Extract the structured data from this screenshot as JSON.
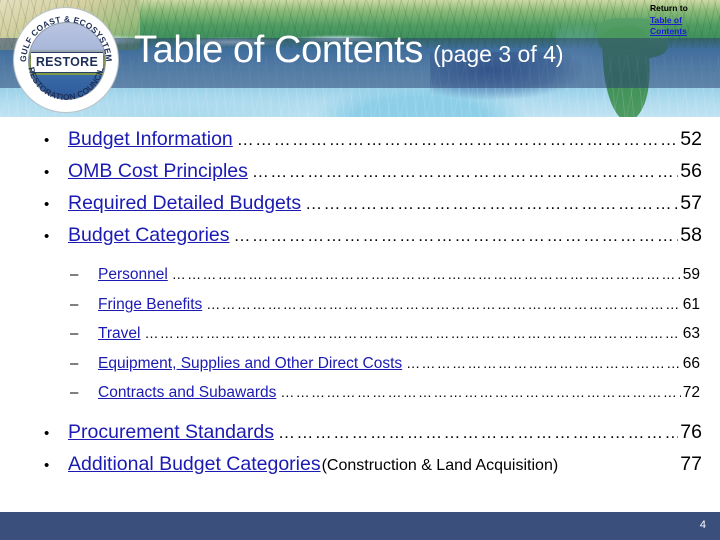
{
  "header": {
    "title_main": "Table of Contents",
    "title_sub": "(page 3 of 4)",
    "logo": {
      "center_text": "RESTORE",
      "arc_top": "GULF COAST & ECOSYSTEM",
      "arc_bottom": "RESTORATION COUNCIL"
    },
    "return_label": "Return to",
    "return_link_line1": "Table of",
    "return_link_line2": "Contents",
    "band_color": "#2a3e70"
  },
  "toc": {
    "leader_dots": "……………………………………………………………………………………………………………………………………",
    "bullet_marker": "•",
    "dash_marker": "–",
    "items": [
      {
        "label": "Budget Information",
        "page": "52"
      },
      {
        "label": "OMB Cost Principles ",
        "page": "56"
      },
      {
        "label": "Required Detailed Budgets",
        "page": "57"
      },
      {
        "label": "Budget Categories",
        "page": "58"
      }
    ],
    "sub_items": [
      {
        "label": "Personnel",
        "page": "59"
      },
      {
        "label": "Fringe Benefits",
        "page": "61"
      },
      {
        "label": "Travel",
        "page": "63"
      },
      {
        "label": "Equipment, Supplies and Other Direct Costs",
        "page": "66"
      },
      {
        "label": "Contracts and Subawards",
        "page": "72"
      }
    ],
    "tail_items": [
      {
        "label": "Procurement Standards",
        "note": "",
        "page": "76"
      },
      {
        "label": "Additional Budget Categories ",
        "note": "(Construction & Land Acquisition)",
        "page": "77"
      }
    ]
  },
  "footer": {
    "page_number": "4",
    "bar_color": "#3b4f7d"
  },
  "colors": {
    "link": "#1b1bb4",
    "text": "#000000",
    "title": "#ffffff"
  }
}
